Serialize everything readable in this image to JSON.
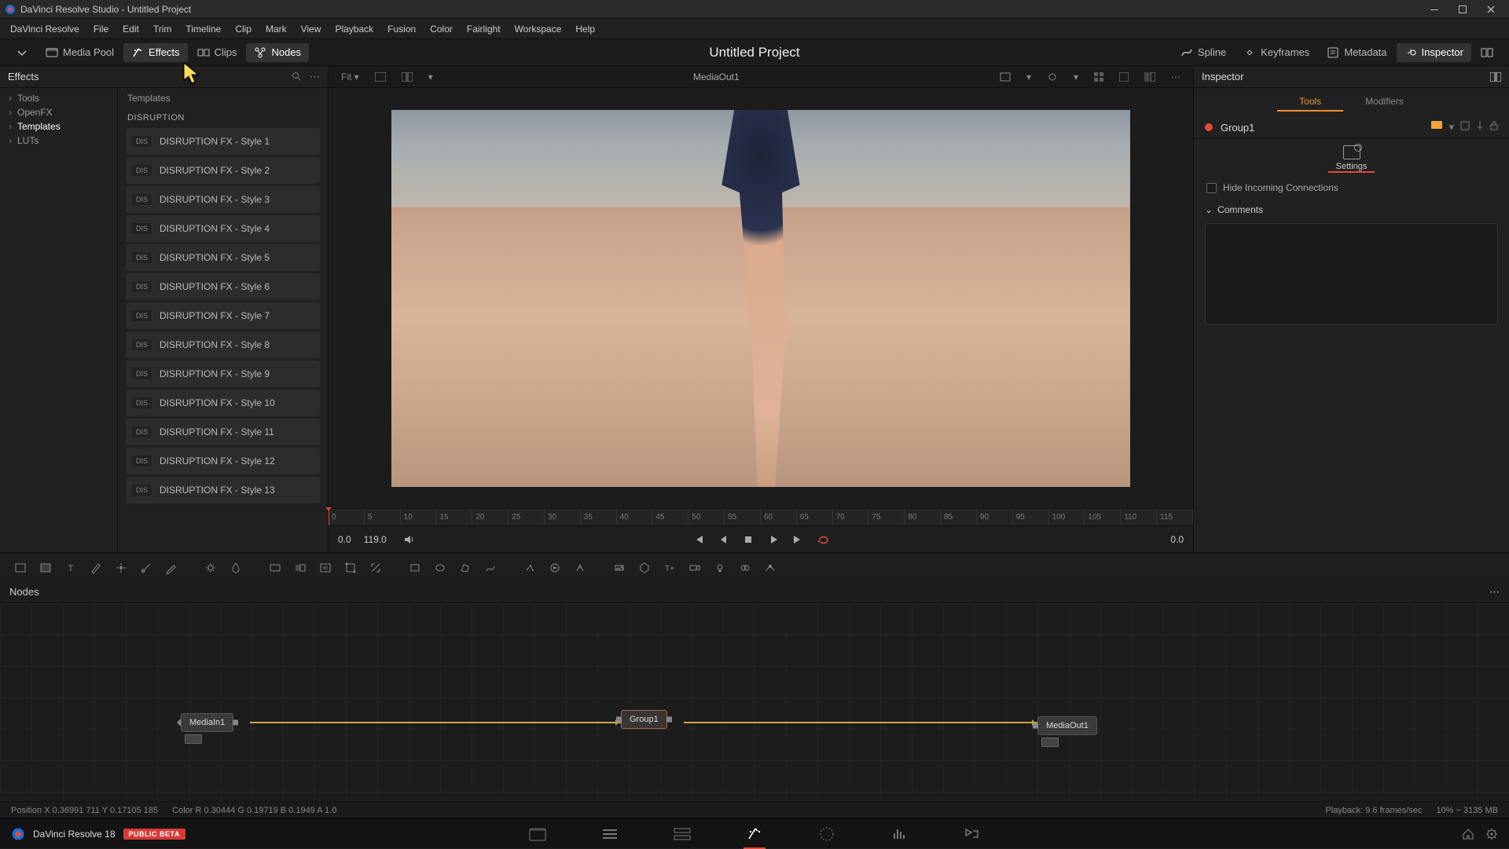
{
  "titlebar": {
    "title": "DaVinci Resolve Studio - Untitled Project"
  },
  "menubar": [
    "DaVinci Resolve",
    "File",
    "Edit",
    "Trim",
    "Timeline",
    "Clip",
    "Mark",
    "View",
    "Playback",
    "Fusion",
    "Color",
    "Fairlight",
    "Workspace",
    "Help"
  ],
  "toolbar": {
    "media_pool": "Media Pool",
    "effects": "Effects",
    "clips": "Clips",
    "nodes": "Nodes",
    "project_title": "Untitled Project",
    "spline": "Spline",
    "keyframes": "Keyframes",
    "metadata": "Metadata",
    "inspector": "Inspector"
  },
  "effects_panel": {
    "title": "Effects",
    "tree": [
      {
        "label": "Tools",
        "selected": false
      },
      {
        "label": "OpenFX",
        "selected": false
      },
      {
        "label": "Templates",
        "selected": true
      },
      {
        "label": "LUTs",
        "selected": false
      }
    ],
    "templates_tab": "Templates",
    "category": "DISRUPTION",
    "pill": "DIS",
    "items": [
      "DISRUPTION FX - Style 1",
      "DISRUPTION FX - Style 2",
      "DISRUPTION FX - Style 3",
      "DISRUPTION FX - Style 4",
      "DISRUPTION FX - Style 5",
      "DISRUPTION FX - Style 6",
      "DISRUPTION FX - Style 7",
      "DISRUPTION FX - Style 8",
      "DISRUPTION FX - Style 9",
      "DISRUPTION FX - Style 10",
      "DISRUPTION FX - Style 11",
      "DISRUPTION FX - Style 12",
      "DISRUPTION FX - Style 13"
    ]
  },
  "viewer": {
    "fit": "Fit",
    "name": "MediaOut1",
    "ruler": [
      "0",
      "5",
      "10",
      "15",
      "20",
      "25",
      "30",
      "35",
      "40",
      "45",
      "50",
      "55",
      "60",
      "65",
      "70",
      "75",
      "80",
      "85",
      "90",
      "95",
      "100",
      "105",
      "110",
      "115"
    ],
    "time_start": "0.0",
    "time_end": "119.0",
    "time_right": "0.0"
  },
  "inspector": {
    "title": "Inspector",
    "tabs": {
      "tools": "Tools",
      "modifiers": "Modifiers"
    },
    "node_name": "Group1",
    "settings_tab": "Settings",
    "hide_incoming": "Hide Incoming Connections",
    "comments": "Comments"
  },
  "nodes_panel": {
    "title": "Nodes",
    "n1": "MediaIn1",
    "n2": "Group1",
    "n3": "MediaOut1"
  },
  "status": {
    "position": "Position   X 0.36991    711    Y 0.17105    185",
    "color": "Color  R 0.30444    G 0.19719    B 0.1949    A 1.0",
    "playback": "Playback: 9.6 frames/sec",
    "mem": "10% ~ 3135 MB"
  },
  "pagebar": {
    "app": "DaVinci Resolve 18",
    "badge": "PUBLIC BETA"
  }
}
